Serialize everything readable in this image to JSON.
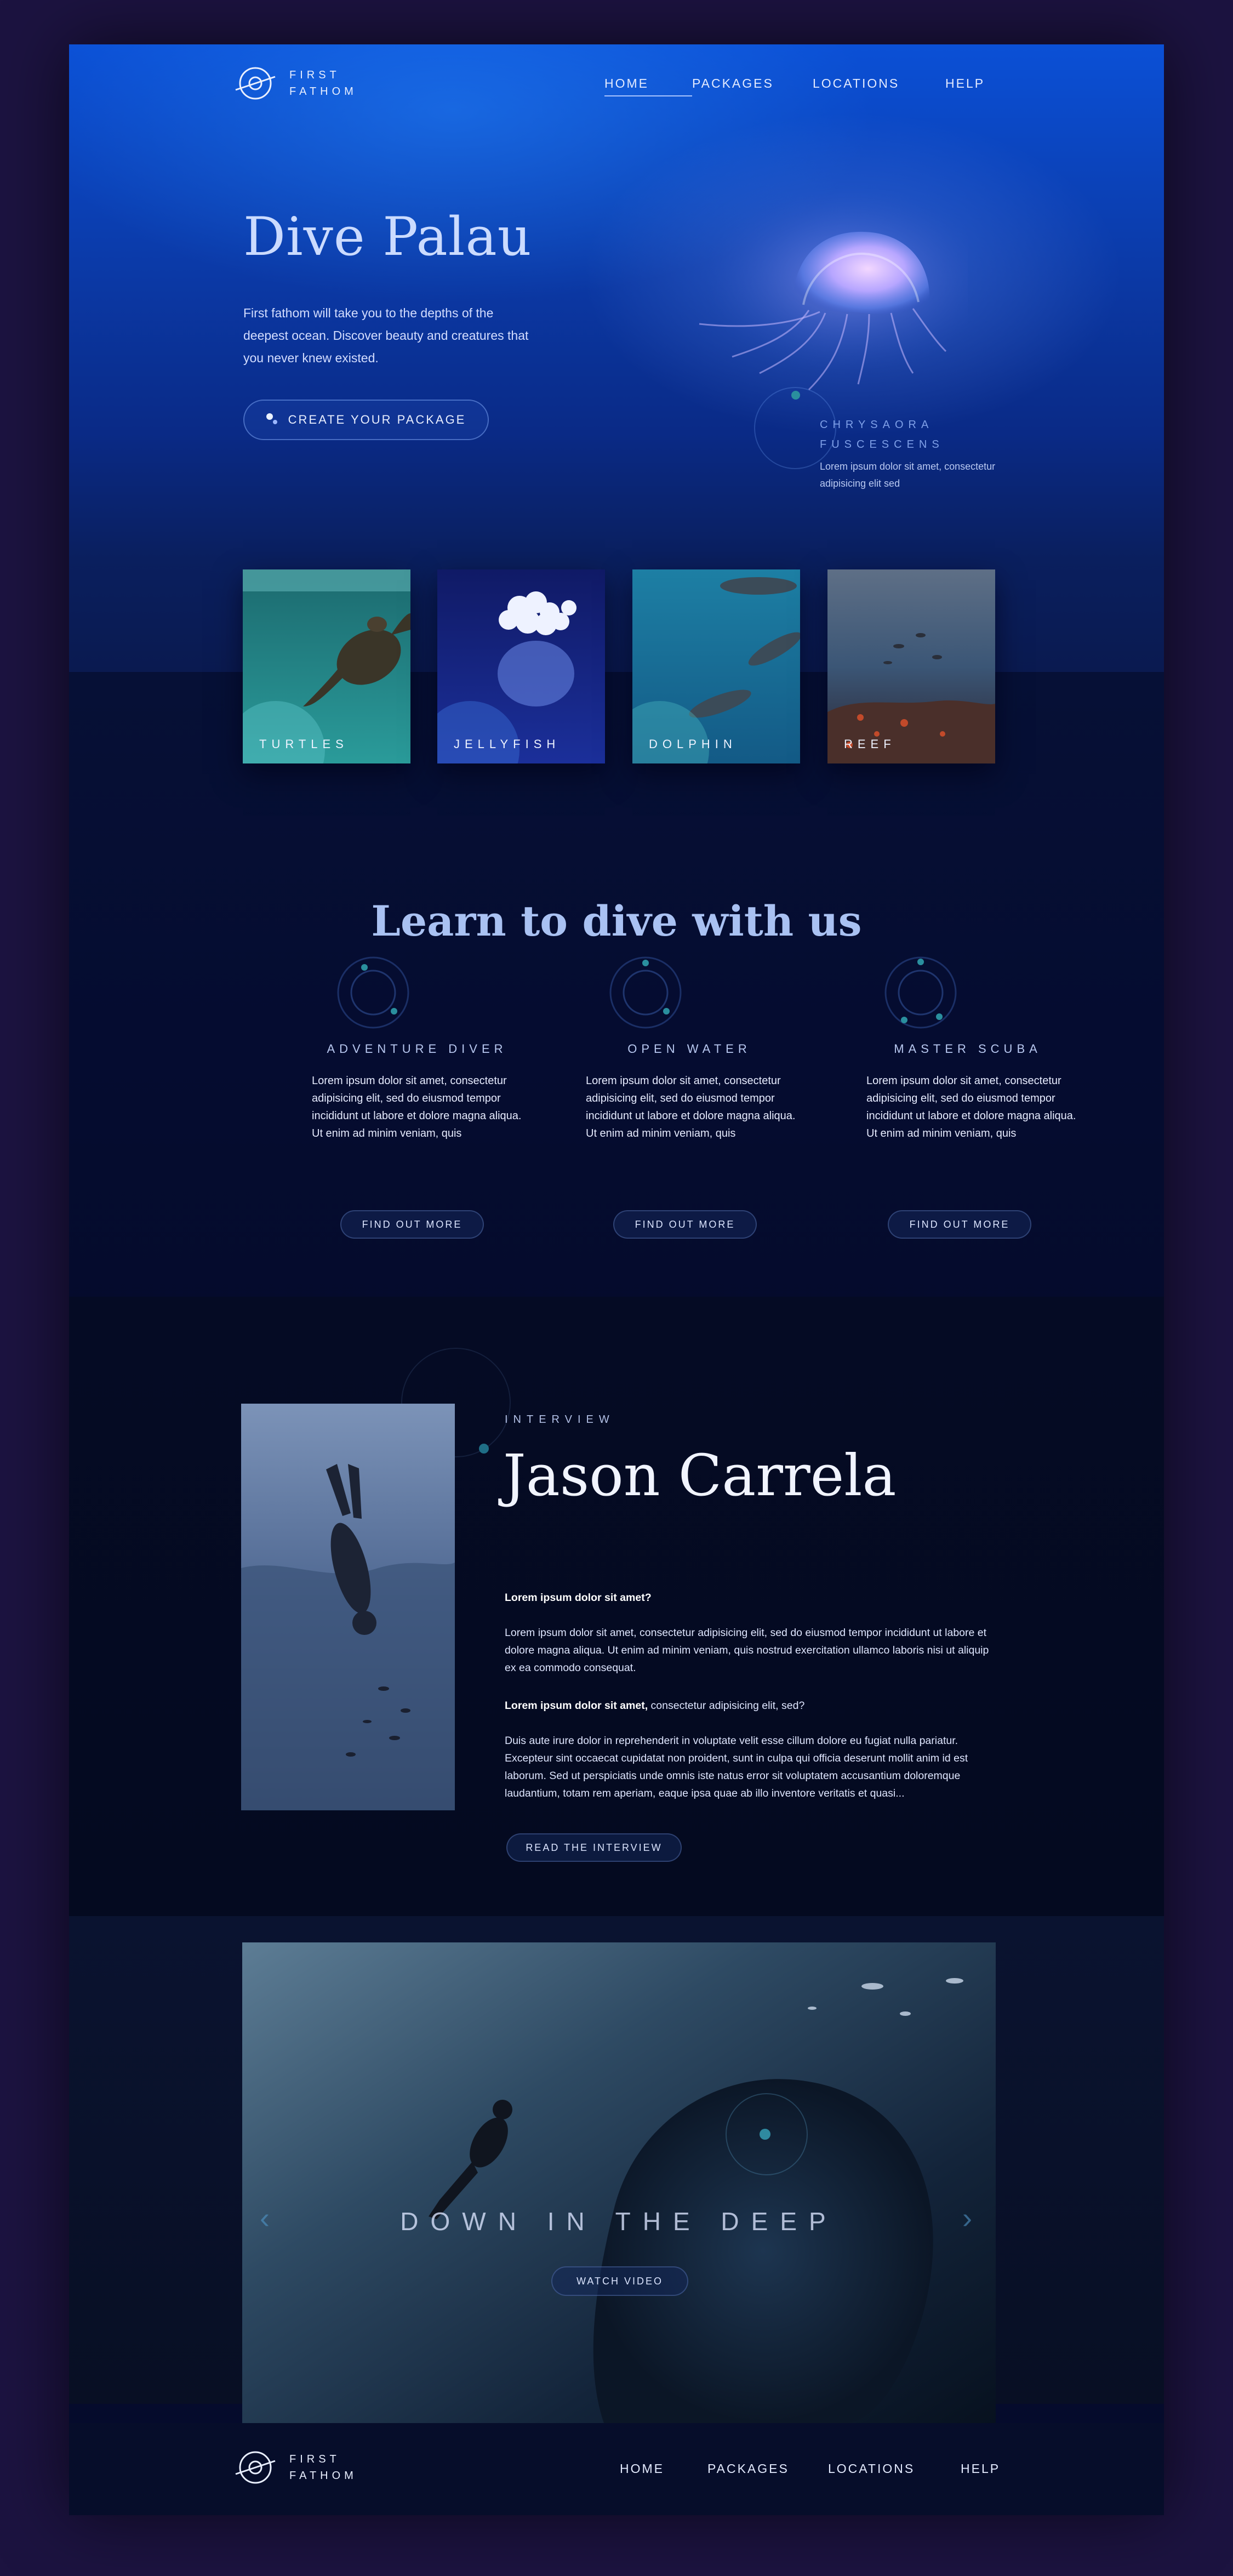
{
  "brand": {
    "name": "FIRST\nFATHOM"
  },
  "nav": {
    "items": [
      "HOME",
      "PACKAGES",
      "LOCATIONS",
      "HELP"
    ],
    "active": "HOME"
  },
  "hero": {
    "title": "Dive Palau",
    "text": "First fathom will take you to the depths of the deepest ocean. Discover beauty and creatures that you never knew existed.",
    "cta": "CREATE YOUR PACKAGE",
    "species_name": "CHRYSAORA FUSCESCENS",
    "species_desc": "Lorem ipsum dolor sit amet, consectetur adipisicing elit sed"
  },
  "cards": [
    {
      "label": "TURTLES"
    },
    {
      "label": "JELLYFISH"
    },
    {
      "label": "DOLPHIN"
    },
    {
      "label": "REEF"
    }
  ],
  "learn": {
    "title": "Learn to dive with us",
    "courses": [
      {
        "name": "ADVENTURE DIVER",
        "text": "Lorem ipsum dolor sit amet, consectetur adipisicing elit, sed do eiusmod tempor incididunt ut labore et dolore magna aliqua. Ut enim ad minim veniam, quis",
        "button": "FIND OUT MORE"
      },
      {
        "name": "OPEN WATER",
        "text": "Lorem ipsum dolor sit amet, consectetur adipisicing elit, sed do eiusmod tempor incididunt ut labore et dolore magna aliqua. Ut enim ad minim veniam, quis",
        "button": "FIND OUT MORE"
      },
      {
        "name": "MASTER SCUBA",
        "text": "Lorem ipsum dolor sit amet, consectetur adipisicing elit, sed do eiusmod tempor incididunt ut labore et dolore magna aliqua. Ut enim ad minim veniam, quis",
        "button": "FIND OUT MORE"
      }
    ]
  },
  "interview": {
    "label": "INTERVIEW",
    "name": "Jason Carrela",
    "q1": "Lorem ipsum dolor sit amet?",
    "a1": "Lorem ipsum dolor sit amet, consectetur adipisicing elit, sed do eiusmod tempor incididunt ut labore et dolore magna aliqua. Ut enim ad minim veniam, quis nostrud exercitation ullamco laboris nisi ut aliquip ex ea commodo consequat.",
    "q2_bold": "Lorem ipsum dolor sit amet,",
    "q2_rest": " consectetur adipisicing elit, sed?",
    "a2": "Duis aute irure dolor in reprehenderit in voluptate velit esse cillum dolore eu fugiat nulla pariatur. Excepteur sint occaecat cupidatat non proident, sunt in culpa qui officia deserunt mollit anim id est laborum. Sed ut perspiciatis unde omnis iste natus error sit voluptatem accusantium doloremque laudantium, totam rem aperiam, eaque ipsa quae ab illo inventore veritatis et quasi...",
    "button": "READ THE INTERVIEW"
  },
  "video": {
    "title": "DOWN IN THE DEEP",
    "button": "WATCH VIDEO"
  },
  "footer": {
    "brand": "FIRST\nFATHOM",
    "nav": [
      "HOME",
      "PACKAGES",
      "LOCATIONS",
      "HELP"
    ]
  }
}
